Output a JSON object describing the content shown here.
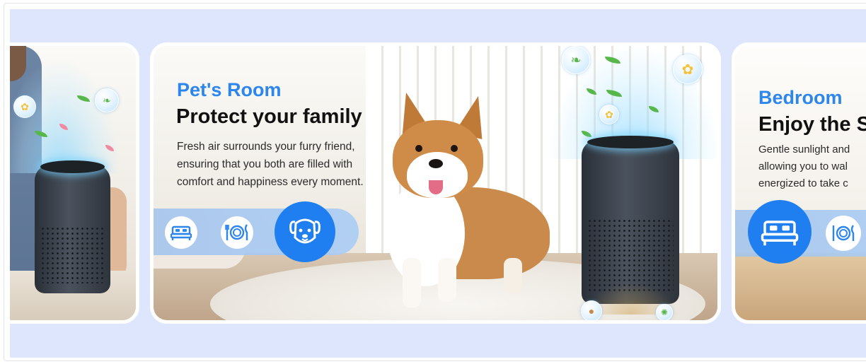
{
  "cards": {
    "left": {
      "purifier_label": ""
    },
    "middle": {
      "room": "Pet's Room",
      "headline": "Protect your family",
      "description_lines": [
        "Fresh air surrounds your furry friend,",
        "ensuring that you both are filled with",
        "comfort and happiness every moment."
      ],
      "icons": [
        "bed-icon",
        "dining-icon",
        "dog-icon"
      ],
      "active_icon": "dog-icon"
    },
    "right": {
      "room": "Bedroom",
      "headline": "Enjoy the S",
      "description_lines": [
        "Gentle sunlight and",
        "allowing you to wal",
        "energized to take c"
      ],
      "icons": [
        "bed-icon",
        "dining-icon"
      ],
      "active_icon": "bed-icon"
    }
  },
  "colors": {
    "band_background": "#dde6fd",
    "accent_blue": "#2d86ec",
    "active_icon_blue": "#1f7ff0",
    "purifier_body": "#333a43"
  }
}
